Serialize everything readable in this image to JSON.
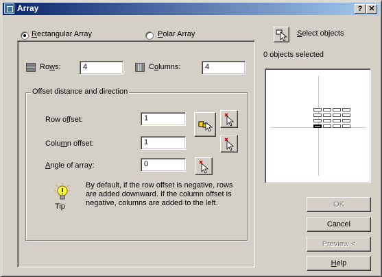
{
  "window": {
    "title": "Array",
    "help_button": "?",
    "close_button": "✕"
  },
  "array_type": {
    "rectangular_label_u": "R",
    "rectangular_label_rest": "ectangular Array",
    "polar_label_u": "P",
    "polar_label_rest": "olar Array",
    "selected": "Rectangular Array"
  },
  "grid": {
    "rows_label_pre": "Ro",
    "rows_label_u": "w",
    "rows_label_post": "s:",
    "rows_value": "4",
    "columns_label_pre": "C",
    "columns_label_u": "o",
    "columns_label_post": "lumns:",
    "columns_value": "4"
  },
  "offset": {
    "group_label": "Offset distance and direction",
    "row_offset_pre": "Row o",
    "row_offset_u": "f",
    "row_offset_post": "fset:",
    "row_offset_value": "1",
    "column_offset_pre": "Colu",
    "column_offset_u": "m",
    "column_offset_post": "n offset:",
    "column_offset_value": "1",
    "angle_u": "A",
    "angle_post": "ngle of array:",
    "angle_value": "0"
  },
  "tip": {
    "label": "Tip",
    "text": "By default, if the row offset is negative, rows are added downward.  If the column offset is negative, columns are added to the left."
  },
  "selection": {
    "select_objects_u": "S",
    "select_objects_rest": "elect objects",
    "objects_selected": "0 objects selected"
  },
  "buttons": {
    "ok": "OK",
    "cancel": "Cancel",
    "preview": "Preview <",
    "help_u": "H",
    "help_rest": "elp"
  },
  "colors": {
    "title_start": "#0a246a",
    "title_end": "#a6caf0",
    "face": "#d4d0c8"
  }
}
